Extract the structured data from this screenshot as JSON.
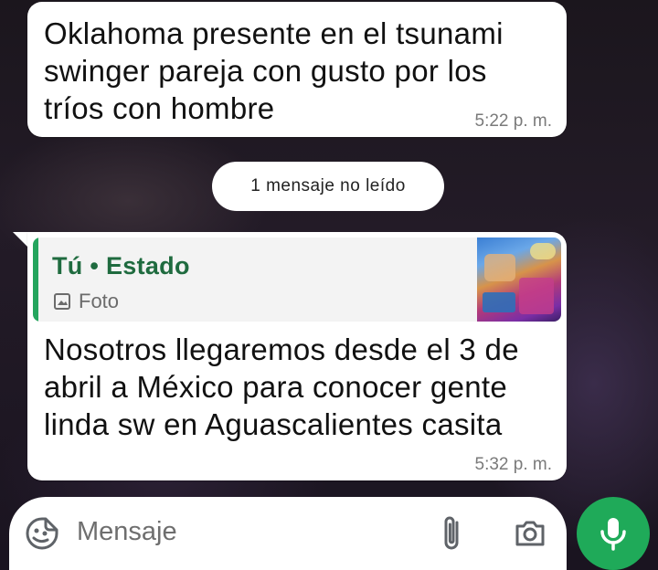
{
  "messages": [
    {
      "text": "Oklahoma presente en el tsunami swinger pareja con gusto por los tríos con hombre",
      "time": "5:22 p. m."
    },
    {
      "quote": {
        "author": "Tú • Estado",
        "media_label": "Foto",
        "media_icon": "image-icon"
      },
      "text": "Nosotros llegaremos desde el 3 de abril a México para conocer gente linda sw en Aguascalientes casita",
      "time": "5:32 p. m."
    }
  ],
  "unread_banner": "1 mensaje no leído",
  "composer": {
    "placeholder": "Mensaje",
    "icons": [
      "sticker-icon",
      "paperclip-icon",
      "camera-icon",
      "microphone-icon"
    ]
  },
  "colors": {
    "accent_green": "#1faa59",
    "quote_author": "#1f6b3f",
    "quote_bar": "#25a55e"
  }
}
